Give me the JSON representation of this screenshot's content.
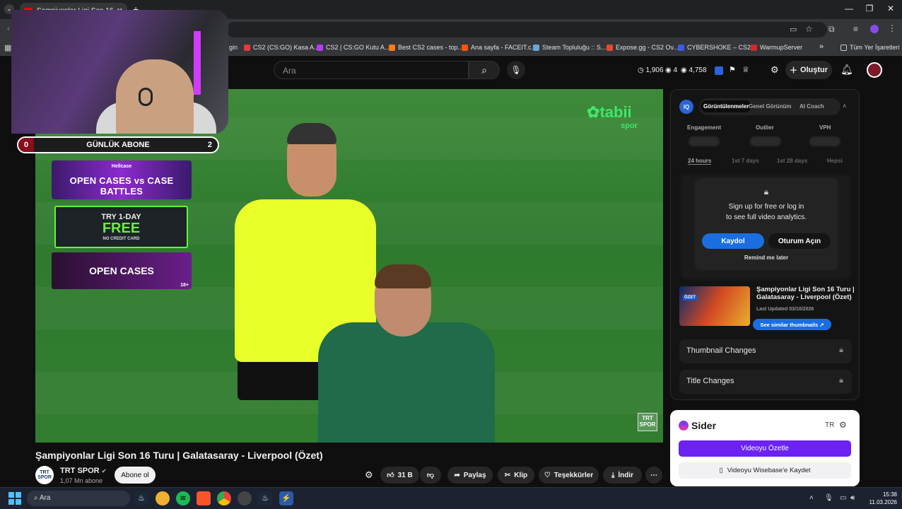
{
  "browser": {
    "tab_title": "Şampiyonlar Ligi Son 16 Turu |",
    "tab_close": "✕",
    "new_tab": "+",
    "window_controls": [
      "—",
      "❐",
      "✕"
    ],
    "bookmarks": [
      {
        "label": "gin",
        "color": "#555"
      },
      {
        "label": "CS2 (CS:GO) Kasa A...",
        "color": "#e23c3c"
      },
      {
        "label": "CS2 | CS:GO Kutu A...",
        "color": "#b23cff"
      },
      {
        "label": "Best CS2 cases - top...",
        "color": "#ff7a1a"
      },
      {
        "label": "Ana sayfa - FACEIT.c...",
        "color": "#ff5500"
      },
      {
        "label": "Steam Topluluğu :: S...",
        "color": "#6aa6d8"
      },
      {
        "label": "Expose.gg - CS2 Ov...",
        "color": "#e84a2a"
      },
      {
        "label": "CYBERSHOKE – CS2...",
        "color": "#3c5ae8"
      },
      {
        "label": "WarmupServer",
        "color": "#d02a2a"
      }
    ],
    "bookmarks_more": "»",
    "all_bookmarks": "Tüm Yer İşaretleri"
  },
  "masthead": {
    "search_placeholder": "Ara",
    "stats": {
      "clock": "1,906",
      "eye_small": "4",
      "views": "4,758"
    },
    "create_label": "Oluştur"
  },
  "overlay": {
    "sub_left": "0",
    "sub_label": "GÜNLÜK ABONE",
    "sub_right": "2",
    "promo1_brand": "Hellcase",
    "promo1_text": "OPEN CASES vs CASE BATTLES",
    "promo2_top": "TRY 1-DAY",
    "promo2_big": "FREE",
    "promo2_small": "NO CREDIT CARD",
    "promo3_text": "OPEN CASES",
    "promo3_age": "18+"
  },
  "player": {
    "logo": "tabii",
    "logo_sub": "spor",
    "watermark": "TRT SPOR"
  },
  "video": {
    "title": "Şampiyonlar Ligi Son 16 Turu | Galatasaray - Liverpool (Özet)",
    "channel": "TRT SPOR",
    "channel_badge": "✔",
    "subscribers": "1,07 Mn abone",
    "avatar_text": "TRT SPOR",
    "subscribe": "Abone ol",
    "likes": "31 B",
    "share": "Paylaş",
    "clip": "Klip",
    "thanks": "Teşekkürler",
    "download": "İndir"
  },
  "iq": {
    "badge": "IQ",
    "tabs": [
      "Görüntülenmeler",
      "Genel Görünüm",
      "AI Coach"
    ],
    "metrics": [
      "Engagement",
      "Outlier",
      "VPH"
    ],
    "ranges": [
      "24 hours",
      "1st 7 days",
      "1st 28 days",
      "Hepsi"
    ],
    "lock_msg_1": "Sign up for free or log in",
    "lock_msg_2": "to see full video analytics.",
    "signup": "Kaydol",
    "login": "Oturum Açın",
    "remind": "Remind me later",
    "thumb_badge": "ÖZET",
    "thumb_title": "Şampiyonlar Ligi Son 16 Turu | Galatasaray - Liverpool (Özet)",
    "updated": "Last Updated 03/10/2026",
    "similar": "See similar thumbnails ↗",
    "thumbnail_changes": "Thumbnail Changes",
    "title_changes": "Title Changes"
  },
  "sider": {
    "name": "Sider",
    "lang": "TR",
    "summarize": "Videoyu Özetle",
    "save": "Videoyu Wisebase'e Kaydet"
  },
  "taskbar": {
    "search": "Ara",
    "time": "15:38",
    "date": "11.03.2026"
  },
  "colors": {
    "accent_blue": "#1a6ee0",
    "sider_purple": "#6b22f2",
    "tabii_green": "#3fe66b"
  }
}
